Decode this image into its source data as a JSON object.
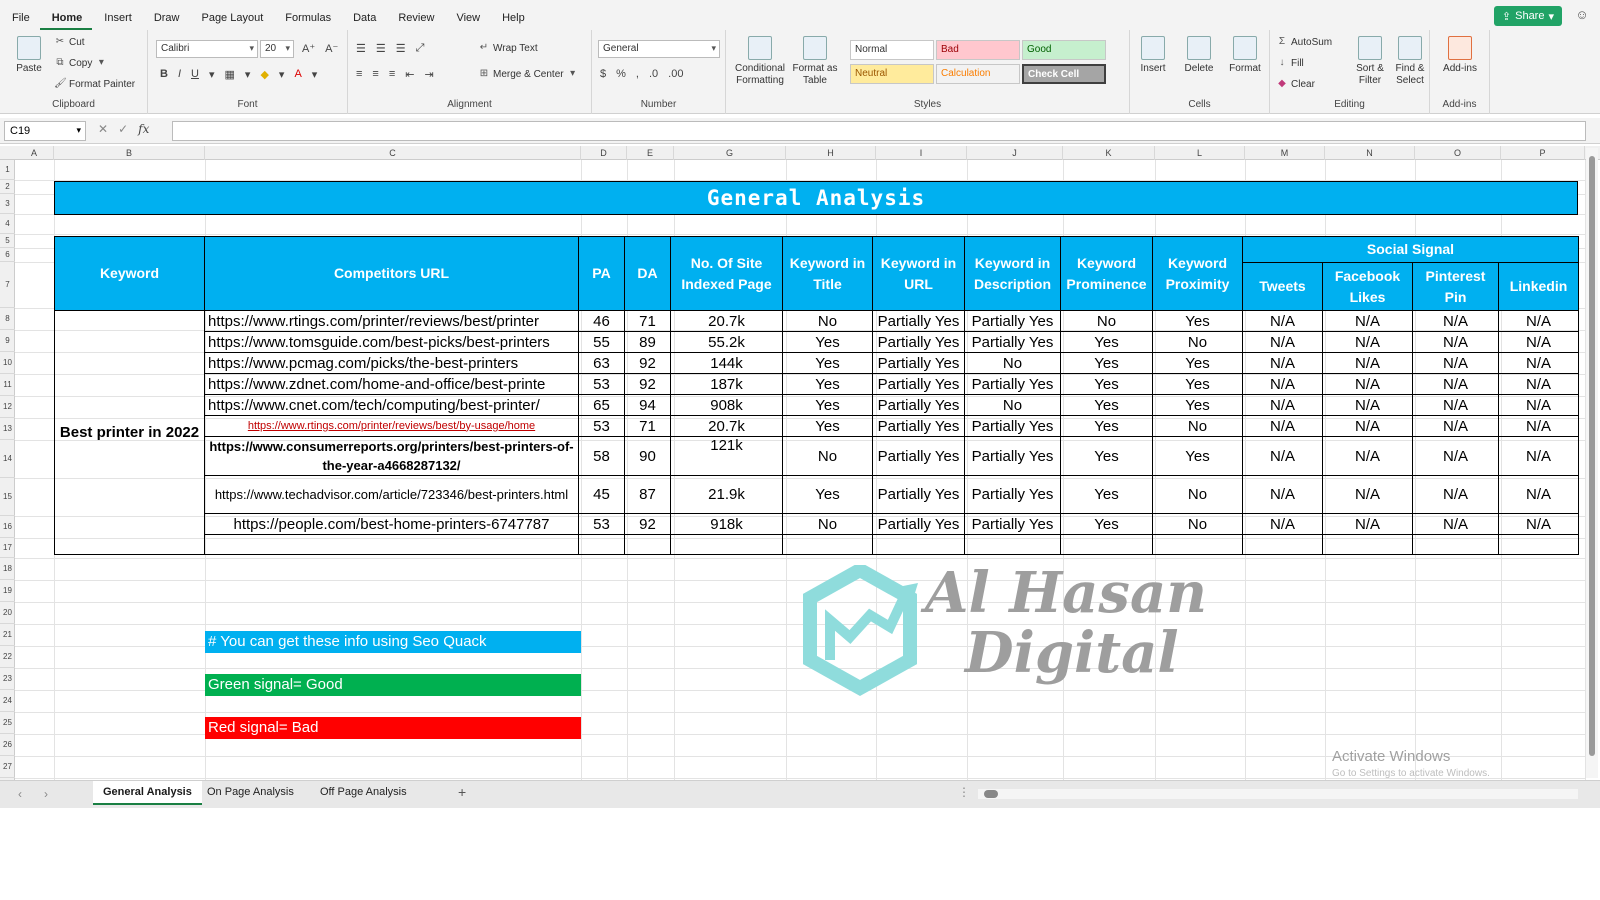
{
  "menu": [
    "File",
    "Home",
    "Insert",
    "Draw",
    "Page Layout",
    "Formulas",
    "Data",
    "Review",
    "View",
    "Help"
  ],
  "share_label": "Share",
  "ribbon": {
    "clipboard": {
      "paste": "Paste",
      "cut": "Cut",
      "copy": "Copy",
      "format_painter": "Format Painter",
      "label": "Clipboard"
    },
    "font": {
      "name": "Calibri",
      "size": "20",
      "label": "Font"
    },
    "alignment": {
      "wrap_text": "Wrap Text",
      "merge_center": "Merge & Center",
      "label": "Alignment"
    },
    "number": {
      "format": "General",
      "label": "Number"
    },
    "styles": {
      "conditional": "Conditional Formatting",
      "format_table": "Format as Table",
      "normal": "Normal",
      "bad": "Bad",
      "good": "Good",
      "neutral": "Neutral",
      "calculation": "Calculation",
      "check_cell": "Check Cell",
      "label": "Styles"
    },
    "cells": {
      "insert": "Insert",
      "delete": "Delete",
      "format": "Format",
      "label": "Cells"
    },
    "editing": {
      "autosum": "AutoSum",
      "fill": "Fill",
      "clear": "Clear",
      "sort_filter": "Sort & Filter",
      "find_select": "Find & Select",
      "label": "Editing"
    },
    "addins": {
      "addins": "Add-ins",
      "label": "Add-ins"
    }
  },
  "formula_bar": {
    "cell_ref": "C19",
    "fx": "fx",
    "value": ""
  },
  "columns": [
    "A",
    "B",
    "C",
    "D",
    "E",
    "G",
    "H",
    "I",
    "J",
    "K",
    "L",
    "M",
    "N",
    "O",
    "P"
  ],
  "rows": [
    "1",
    "2",
    "3",
    "4",
    "5",
    "6",
    "7",
    "8",
    "9",
    "10",
    "11",
    "12",
    "13",
    "14",
    "15",
    "16",
    "17",
    "18",
    "19",
    "20",
    "21",
    "22",
    "23",
    "24",
    "25",
    "26",
    "27"
  ],
  "title": "General Analysis",
  "table": {
    "headers": {
      "keyword": "Keyword",
      "url": "Competitors URL",
      "pa": "PA",
      "da": "DA",
      "indexed": "No. Of Site Indexed Page",
      "kw_title": "Keyword in Title",
      "kw_url": "Keyword in URL",
      "kw_desc": "Keyword in Description",
      "kw_prominence": "Keyword Prominence",
      "kw_proximity": "Keyword Proximity",
      "social": "Social Signal",
      "tweets": "Tweets",
      "facebook": "Facebook Likes",
      "pinterest": "Pinterest Pin",
      "linkedin": "Linkedin"
    },
    "keyword": "Best printer in 2022",
    "rows": [
      {
        "url": "https://www.rtings.com/printer/reviews/best/printer",
        "pa": "46",
        "da": "71",
        "idx": "20.7k",
        "t": "No",
        "u": "Partially Yes",
        "d": "Partially Yes",
        "p": "No",
        "x": "Yes",
        "tw": "N/A",
        "fb": "N/A",
        "pi": "N/A",
        "li": "N/A"
      },
      {
        "url": "https://www.tomsguide.com/best-picks/best-printers",
        "pa": "55",
        "da": "89",
        "idx": "55.2k",
        "t": "Yes",
        "u": "Partially Yes",
        "d": "Partially Yes",
        "p": "Yes",
        "x": "No",
        "tw": "N/A",
        "fb": "N/A",
        "pi": "N/A",
        "li": "N/A"
      },
      {
        "url": "https://www.pcmag.com/picks/the-best-printers",
        "pa": "63",
        "da": "92",
        "idx": "144k",
        "t": "Yes",
        "u": "Partially Yes",
        "d": "No",
        "p": "Yes",
        "x": "Yes",
        "tw": "N/A",
        "fb": "N/A",
        "pi": "N/A",
        "li": "N/A"
      },
      {
        "url": "https://www.zdnet.com/home-and-office/best-printe",
        "pa": "53",
        "da": "92",
        "idx": "187k",
        "t": "Yes",
        "u": "Partially Yes",
        "d": "Partially Yes",
        "p": "Yes",
        "x": "Yes",
        "tw": "N/A",
        "fb": "N/A",
        "pi": "N/A",
        "li": "N/A"
      },
      {
        "url": "https://www.cnet.com/tech/computing/best-printer/",
        "pa": "65",
        "da": "94",
        "idx": "908k",
        "t": "Yes",
        "u": "Partially Yes",
        "d": "No",
        "p": "Yes",
        "x": "Yes",
        "tw": "N/A",
        "fb": "N/A",
        "pi": "N/A",
        "li": "N/A"
      },
      {
        "url": "https://www.rtings.com/printer/reviews/best/by-usage/home",
        "pa": "53",
        "da": "71",
        "idx": "20.7k",
        "t": "Yes",
        "u": "Partially Yes",
        "d": "Partially Yes",
        "p": "Yes",
        "x": "No",
        "tw": "N/A",
        "fb": "N/A",
        "pi": "N/A",
        "li": "N/A"
      },
      {
        "url": "https://www.consumerreports.org/printers/best-printers-of-the-year-a4668287132/",
        "pa": "58",
        "da": "90",
        "idx": "121k",
        "t": "No",
        "u": "Partially Yes",
        "d": "Partially Yes",
        "p": "Yes",
        "x": "Yes",
        "tw": "N/A",
        "fb": "N/A",
        "pi": "N/A",
        "li": "N/A"
      },
      {
        "url": "https://www.techadvisor.com/article/723346/best-printers.html",
        "pa": "45",
        "da": "87",
        "idx": "21.9k",
        "t": "Yes",
        "u": "Partially Yes",
        "d": "Partially Yes",
        "p": "Yes",
        "x": "No",
        "tw": "N/A",
        "fb": "N/A",
        "pi": "N/A",
        "li": "N/A"
      },
      {
        "url": "https://people.com/best-home-printers-6747787",
        "pa": "53",
        "da": "92",
        "idx": "918k",
        "t": "No",
        "u": "Partially Yes",
        "d": "Partially Yes",
        "p": "Yes",
        "x": "No",
        "tw": "N/A",
        "fb": "N/A",
        "pi": "N/A",
        "li": "N/A"
      }
    ]
  },
  "notes": {
    "seo_quack": "# You can get these info using Seo Quack",
    "green": "Green signal= Good",
    "red": "Red signal= Bad"
  },
  "watermark": {
    "line1": "Al Hasan",
    "line2": "Digital"
  },
  "activate": {
    "title": "Activate Windows",
    "sub": "Go to Settings to activate Windows."
  },
  "sheets": [
    "General Analysis",
    "On Page Analysis",
    "Off Page Analysis"
  ],
  "colors": {
    "header_blue": "#00b0f0",
    "good_green": "#00b050",
    "bad_red": "#ff0000",
    "excel_green": "#1a7f43"
  }
}
